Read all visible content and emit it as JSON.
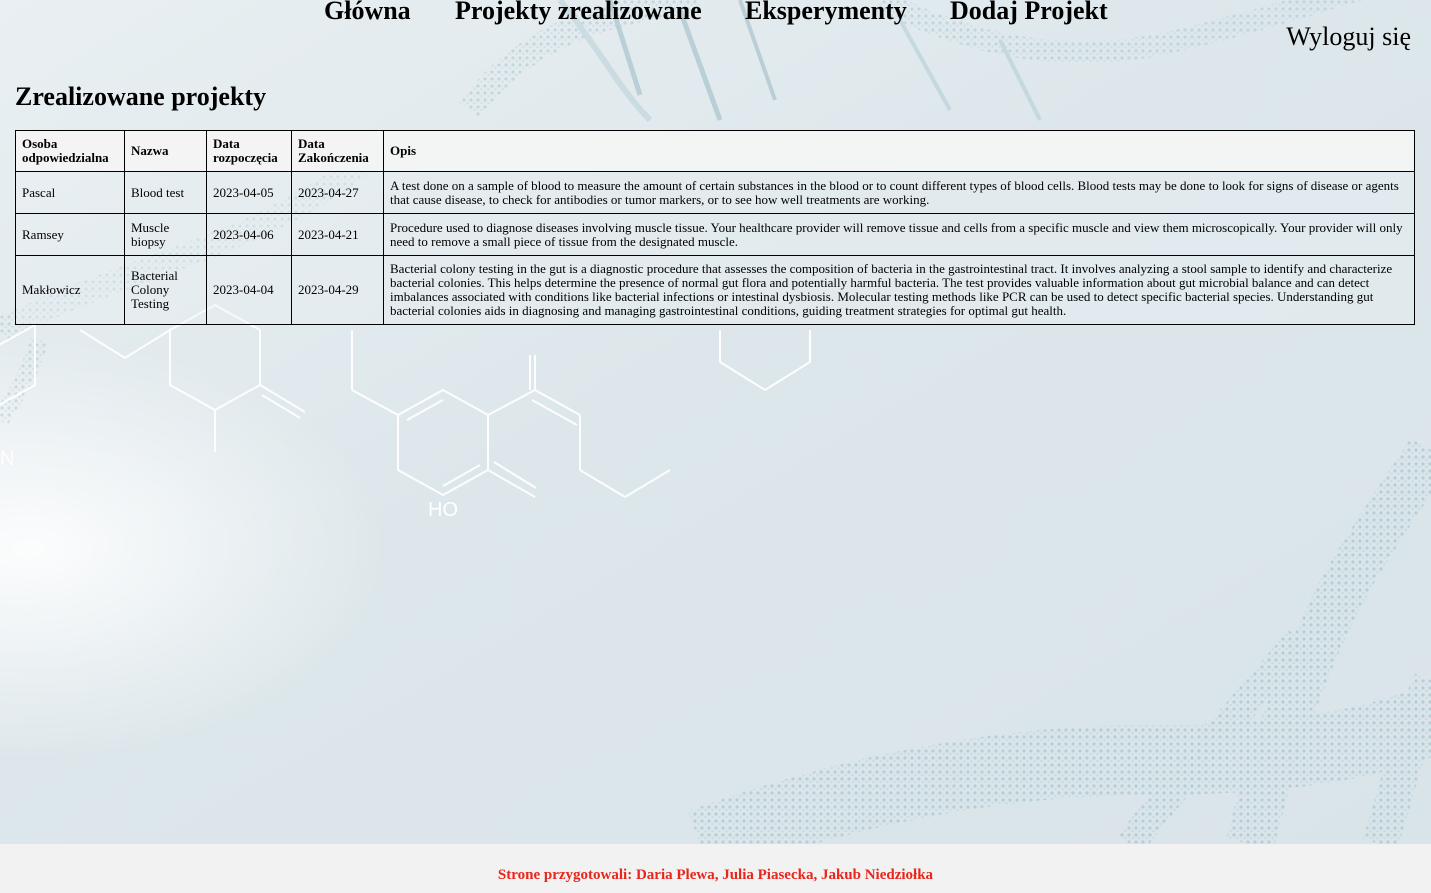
{
  "nav": {
    "items": [
      {
        "label": "Główna"
      },
      {
        "label": "Projekty zrealizowane"
      },
      {
        "label": "Eksperymenty"
      },
      {
        "label": "Dodaj Projekt"
      }
    ],
    "logout_label": "Wyloguj się"
  },
  "page": {
    "title": "Zrealizowane projekty"
  },
  "table": {
    "headers": {
      "person": "Osoba odpowiedzialna",
      "name": "Nazwa",
      "start": "Data rozpoczęcia",
      "end": "Data Zakończenia",
      "description": "Opis"
    },
    "rows": [
      {
        "person": "Pascal",
        "name": "Blood test",
        "start": "2023-04-05",
        "end": "2023-04-27",
        "description": "A test done on a sample of blood to measure the amount of certain substances in the blood or to count different types of blood cells. Blood tests may be done to look for signs of disease or agents that cause disease, to check for antibodies or tumor markers, or to see how well treatments are working."
      },
      {
        "person": "Ramsey",
        "name": "Muscle biopsy",
        "start": "2023-04-06",
        "end": "2023-04-21",
        "description": "Procedure used to diagnose diseases involving muscle tissue. Your healthcare provider will remove tissue and cells from a specific muscle and view them microscopically. Your provider will only need to remove a small piece of tissue from the designated muscle."
      },
      {
        "person": "Makłowicz",
        "name": "Bacterial Colony Testing",
        "start": "2023-04-04",
        "end": "2023-04-29",
        "description": "Bacterial colony testing in the gut is a diagnostic procedure that assesses the composition of bacteria in the gastrointestinal tract. It involves analyzing a stool sample to identify and characterize bacterial colonies. This helps determine the presence of normal gut flora and potentially harmful bacteria. The test provides valuable information about gut microbial balance and can detect imbalances associated with conditions like bacterial infections or intestinal dysbiosis. Molecular testing methods like PCR can be used to detect specific bacterial species. Understanding gut bacterial colonies aids in diagnosing and managing gastrointestinal conditions, guiding treatment strategies for optimal gut health."
      }
    ]
  },
  "background": {
    "molecule_label": "HO"
  },
  "footer": {
    "text": "Strone przygotowali: Daria Plewa, Julia Piasecka, Jakub Niedziołka"
  },
  "colors": {
    "footer_text": "#e8261c",
    "background": "#dfe8ec",
    "dna_helix": "#9fc2cf"
  }
}
